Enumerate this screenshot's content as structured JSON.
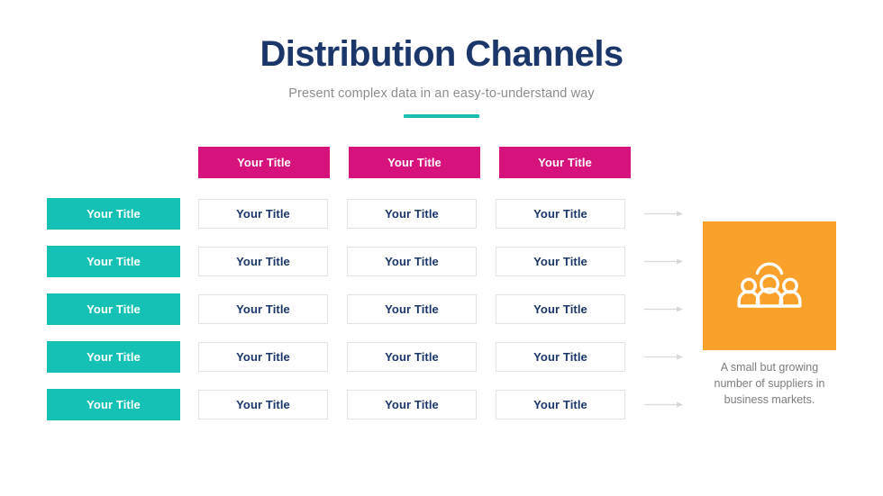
{
  "header": {
    "title": "Distribution Channels",
    "subtitle": "Present complex data in an easy-to-understand way",
    "accent_color": "#18bfb2"
  },
  "colors": {
    "title": "#1b3668",
    "subtitle": "#8d8d91",
    "column_header_bg": "#d6127d",
    "row_header_bg": "#15c1b4",
    "cell_border": "#e3e3e5",
    "cell_text": "#1b3668",
    "icon_box_bg": "#f9a12b",
    "arrow": "#d9d9dc",
    "background": "#ffffff"
  },
  "matrix": {
    "column_headers": [
      {
        "label": "Your Title"
      },
      {
        "label": "Your Title"
      },
      {
        "label": "Your Title"
      }
    ],
    "rows": [
      {
        "header": "Your Title",
        "cells": [
          "Your Title",
          "Your Title",
          "Your Title"
        ],
        "arrow": "arrow-right-icon"
      },
      {
        "header": "Your Title",
        "cells": [
          "Your Title",
          "Your Title",
          "Your Title"
        ],
        "arrow": "arrow-right-icon"
      },
      {
        "header": "Your Title",
        "cells": [
          "Your Title",
          "Your Title",
          "Your Title"
        ],
        "arrow": "arrow-right-icon"
      },
      {
        "header": "Your Title",
        "cells": [
          "Your Title",
          "Your Title",
          "Your Title"
        ],
        "arrow": "arrow-right-icon"
      },
      {
        "header": "Your Title",
        "cells": [
          "Your Title",
          "Your Title",
          "Your Title"
        ],
        "arrow": "arrow-right-icon"
      }
    ]
  },
  "side_panel": {
    "icon": "group-of-people-icon",
    "caption": "A small but growing number of suppliers in business markets."
  }
}
